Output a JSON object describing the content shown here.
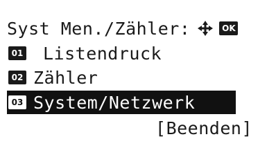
{
  "header": {
    "title": "Syst Men./Zähler:",
    "nav_icon": "↕↔ (4-way arrow)",
    "ok_label": "OK"
  },
  "menu": {
    "items": [
      {
        "number": "01",
        "label": "Listendruck",
        "selected": false
      },
      {
        "number": "02",
        "label": "Zähler",
        "selected": false
      },
      {
        "number": "03",
        "label": "System/Netzwerk",
        "selected": true
      }
    ]
  },
  "footer": {
    "exit_label": "[Beenden]"
  },
  "colors": {
    "background": "#ffffff",
    "text": "#1a1a1a",
    "highlight_bg": "#111111",
    "highlight_text": "#ffffff"
  }
}
